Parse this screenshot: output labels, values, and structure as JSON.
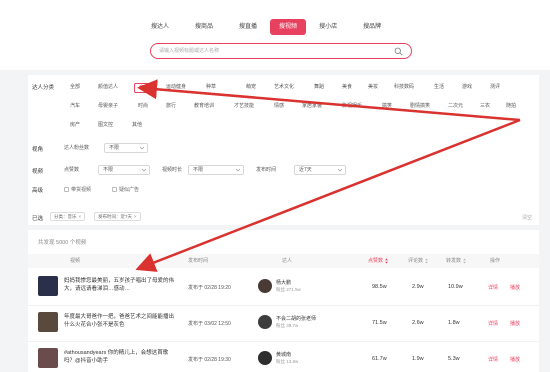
{
  "nav": {
    "items": [
      "搜达人",
      "搜商品",
      "搜直播",
      "搜视频",
      "搜小店",
      "搜品牌"
    ],
    "active_index": 3
  },
  "search": {
    "placeholder": "请输入视频标题或达人名称"
  },
  "filters": {
    "category_label": "达人分类",
    "categories": [
      "全部",
      "颜值达人",
      "音乐",
      "运动健身",
      "种草",
      "萌宠",
      "艺术文化",
      "舞蹈",
      "美食",
      "美妆",
      "科技数码",
      "生活",
      "游戏",
      "测评",
      "汽车",
      "母婴亲子",
      "时尚",
      "旅行",
      "教育培训",
      "才艺技能",
      "情感",
      "家居家装",
      "影视娱乐",
      "搞笑",
      "剧情搞笑",
      "二次元",
      "三农",
      "随拍",
      "房产",
      "图文控",
      "其他"
    ],
    "selected_category": "音乐",
    "view_label": "视角",
    "view_select": "达人粉丝数",
    "view_value": "不限",
    "video_label": "视频",
    "likes_label": "点赞数",
    "likes_value": "不限",
    "duration_label": "视频时长",
    "duration_value": "不限",
    "publish_label": "发布时间",
    "publish_value": "近7天",
    "advanced_label": "高级",
    "checkbox_goods": "带货视频",
    "checkbox_ad": "疑似广告",
    "selected_label": "已选",
    "tags": [
      "分类：音乐",
      "发布时间：近7天"
    ],
    "clear_all": "清空"
  },
  "table": {
    "total": "共发现 5000 个视频",
    "headers": [
      "视频",
      "发布时间",
      "达人",
      "点赞数",
      "评论数",
      "转发数",
      "操作"
    ],
    "sorted_header": "点赞数",
    "rows": [
      {
        "title": "妈妈我惨您最美丽，五岁孩子唱出了母爱的伟大，请远请看涕泪…感动…",
        "time": "发布于 02/28 19:20",
        "author": "杨大鹏",
        "fans": "粉丝 271.5w",
        "likes": "98.5w",
        "comments": "2.9w",
        "shares": "10.9w",
        "op_detail": "详情",
        "op_play": "播放",
        "thumb_color": "#2a2f4a"
      },
      {
        "title": "年度最大哥爸作一把，爸爸艺术之间能能播出什么火花合小张不是灰色",
        "time": "发布于 03/02 12:50",
        "author": "不会二胡的张老师",
        "fans": "粉丝 39.7w",
        "likes": "71.5w",
        "comments": "2.6w",
        "shares": "1.8w",
        "op_detail": "详情",
        "op_play": "播放",
        "thumb_color": "#5a4a3e"
      },
      {
        "title": "#athousandyears 你的精儿上，会想这首歌吗？@抖音小助手",
        "time": "发布于 02/28 19:30",
        "author": "黄城南",
        "fans": "粉丝 13.8w",
        "likes": "61.7w",
        "comments": "1.9w",
        "shares": "5.3w",
        "op_detail": "详情",
        "op_play": "播放",
        "thumb_color": "#6b4b4b"
      }
    ]
  },
  "colors": {
    "accent": "#e8415f",
    "annotation": "#d9322f"
  }
}
